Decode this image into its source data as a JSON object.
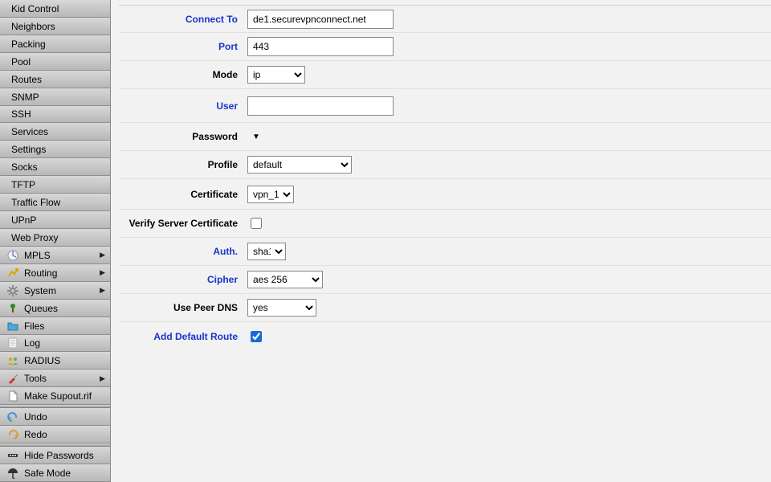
{
  "sidebar": {
    "sub_items": [
      {
        "label": "Kid Control"
      },
      {
        "label": "Neighbors"
      },
      {
        "label": "Packing"
      },
      {
        "label": "Pool"
      },
      {
        "label": "Routes"
      },
      {
        "label": "SNMP"
      },
      {
        "label": "SSH"
      },
      {
        "label": "Services"
      },
      {
        "label": "Settings"
      },
      {
        "label": "Socks"
      },
      {
        "label": "TFTP"
      },
      {
        "label": "Traffic Flow"
      },
      {
        "label": "UPnP"
      },
      {
        "label": "Web Proxy"
      }
    ],
    "top_items": [
      {
        "icon": "mpls",
        "label": "MPLS",
        "submenu": true
      },
      {
        "icon": "routing",
        "label": "Routing",
        "submenu": true
      },
      {
        "icon": "system",
        "label": "System",
        "submenu": true
      },
      {
        "icon": "queues",
        "label": "Queues",
        "submenu": false
      },
      {
        "icon": "files",
        "label": "Files",
        "submenu": false
      },
      {
        "icon": "log",
        "label": "Log",
        "submenu": false
      },
      {
        "icon": "radius",
        "label": "RADIUS",
        "submenu": false
      },
      {
        "icon": "tools",
        "label": "Tools",
        "submenu": true
      },
      {
        "icon": "supout",
        "label": "Make Supout.rif",
        "submenu": false
      }
    ],
    "action_items": [
      {
        "icon": "undo",
        "label": "Undo"
      },
      {
        "icon": "redo",
        "label": "Redo"
      }
    ],
    "bottom_items": [
      {
        "icon": "hide",
        "label": "Hide Passwords"
      },
      {
        "icon": "safe",
        "label": "Safe Mode"
      }
    ]
  },
  "form": {
    "connect_to": {
      "label": "Connect To",
      "value": "de1.securevpnconnect.net"
    },
    "port": {
      "label": "Port",
      "value": "443"
    },
    "mode": {
      "label": "Mode",
      "value": "ip"
    },
    "user": {
      "label": "User",
      "value": ""
    },
    "password": {
      "label": "Password"
    },
    "profile": {
      "label": "Profile",
      "value": "default"
    },
    "certificate": {
      "label": "Certificate",
      "value": "vpn_1"
    },
    "verify_server": {
      "label": "Verify Server Certificate",
      "checked": false
    },
    "auth": {
      "label": "Auth.",
      "value": "sha1"
    },
    "cipher": {
      "label": "Cipher",
      "value": "aes 256"
    },
    "use_peer_dns": {
      "label": "Use Peer DNS",
      "value": "yes"
    },
    "add_default_route": {
      "label": "Add Default Route",
      "checked": true
    }
  }
}
